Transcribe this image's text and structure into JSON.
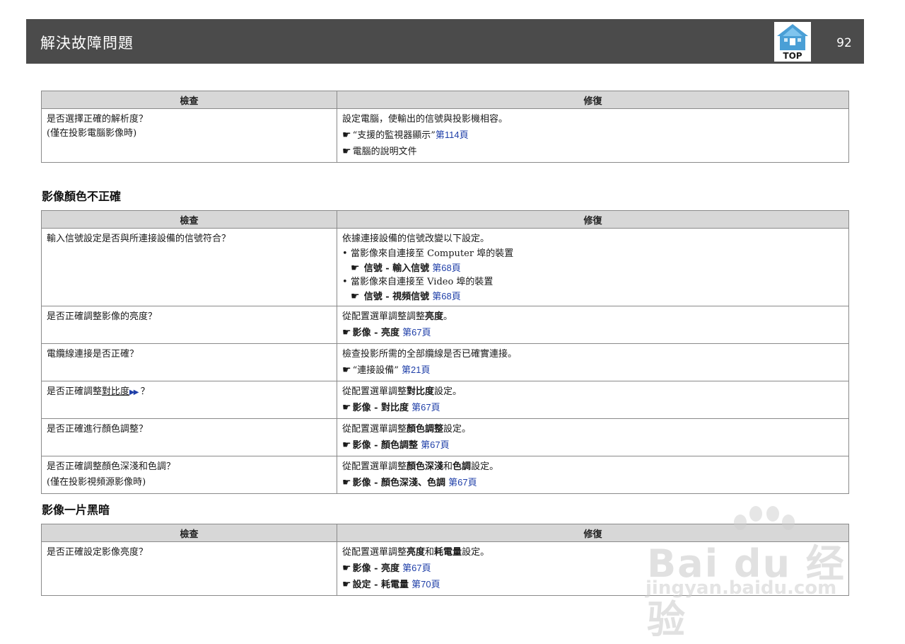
{
  "header": {
    "title": "解決故障問題",
    "top_label": "TOP",
    "page_number": "92"
  },
  "table1": {
    "col_check": "檢查",
    "col_fix": "修復",
    "row1": {
      "check_line1": "是否選擇正確的解析度？",
      "check_line2": "(僅在投影電腦影像時)",
      "fix_line1": "設定電腦，使輸出的信號與投影機相容。",
      "fix_ref1_text": "“支援的監視器顯示”",
      "fix_ref1_page": "第114頁",
      "fix_ref2_text": "電腦的說明文件"
    }
  },
  "section1": {
    "title": "影像顏色不正確"
  },
  "table2": {
    "col_check": "檢查",
    "col_fix": "修復",
    "row1": {
      "check": "輸入信號設定是否與所連接設備的信號符合？",
      "fix_line1": "依據連接設備的信號改變以下設定。",
      "bullet1": "當影像來自連接至 Computer 埠的裝置",
      "bullet1_menu": "信號 - 輸入信號",
      "bullet1_page": "第68頁",
      "bullet2": "當影像來自連接至 Video 埠的裝置",
      "bullet2_menu": "信號 - 視頻信號",
      "bullet2_page": "第68頁"
    },
    "row2": {
      "check": "是否正確調整影像的亮度？",
      "fix_pre": "從配置選單調整調整",
      "fix_bold": "亮度",
      "fix_post": "。",
      "menu": "影像 - 亮度",
      "page": "第67頁"
    },
    "row3": {
      "check": "電纜線連接是否正確？",
      "fix_line1": "檢查投影所需的全部纜線是否已確實連接。",
      "ref_text": "“連接設備”",
      "page": "第21頁"
    },
    "row4": {
      "check_pre": "是否正確調整",
      "check_link": "對比度",
      "check_post": "？",
      "fix_pre": "從配置選單調整",
      "fix_bold": "對比度",
      "fix_post": "設定。",
      "menu": "影像 - 對比度",
      "page": "第67頁"
    },
    "row5": {
      "check": "是否正確進行顏色調整？",
      "fix_pre": "從配置選單調整",
      "fix_bold": "顏色調整",
      "fix_post": "設定。",
      "menu": "影像 - 顏色調整",
      "page": "第67頁"
    },
    "row6": {
      "check_line1": "是否正確調整顏色深淺和色調？",
      "check_line2": "(僅在投影視頻源影像時)",
      "fix_pre": "從配置選單調整",
      "fix_bold1": "顏色深淺",
      "fix_mid": "和",
      "fix_bold2": "色調",
      "fix_post": "設定。",
      "menu": "影像 - 顏色深淺、色調",
      "page": "第67頁"
    }
  },
  "section2": {
    "title": "影像一片黑暗"
  },
  "table3": {
    "col_check": "檢查",
    "col_fix": "修復",
    "row1": {
      "check": "是否正確設定影像亮度？",
      "fix_pre": "從配置選單調整",
      "fix_bold1": "亮度",
      "fix_mid": "和",
      "fix_bold2": "耗電量",
      "fix_post": "設定。",
      "menu1": "影像 - 亮度",
      "page1": "第67頁",
      "menu2": "設定 - 耗電量",
      "page2": "第70頁"
    }
  },
  "watermark": {
    "brand": "Bai du 经验",
    "url": "jingyan.baidu.com"
  },
  "icons": {
    "pointer": "pointing-hand-icon",
    "top": "home-top-icon",
    "glossary": "double-triangle-icon"
  }
}
